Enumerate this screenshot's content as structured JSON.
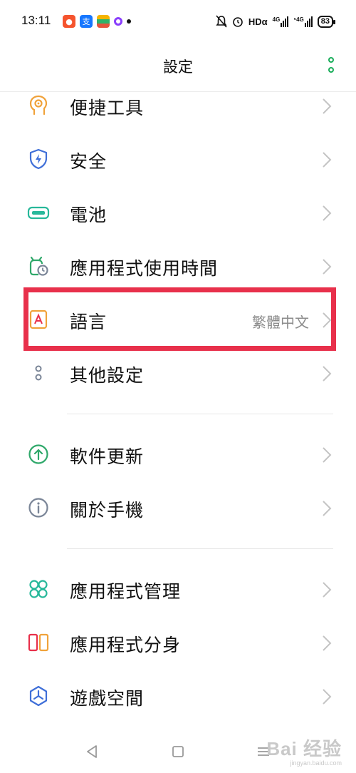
{
  "status_bar": {
    "time": "13:11",
    "hd_label": "HDα",
    "signal1_label": "4G",
    "signal2_label": "⁵4G",
    "battery": "83",
    "app_icon_text": "支"
  },
  "header": {
    "title": "設定"
  },
  "settings": {
    "items": [
      {
        "label": "便捷工具"
      },
      {
        "label": "安全"
      },
      {
        "label": "電池"
      },
      {
        "label": "應用程式使用時間"
      },
      {
        "label": "語言",
        "value": "繁體中文"
      },
      {
        "label": "其他設定"
      },
      {
        "label": "軟件更新"
      },
      {
        "label": "關於手機"
      },
      {
        "label": "應用程式管理"
      },
      {
        "label": "應用程式分身"
      },
      {
        "label": "遊戲空間"
      }
    ]
  },
  "watermark": {
    "main": "Bai 经验",
    "sub": "jingyan.baidu.com"
  },
  "colors": {
    "accent_green": "#1aad5a",
    "highlight_red": "#e8304b",
    "icon_orange": "#f0a23a",
    "icon_blue": "#3f6fd8",
    "icon_teal": "#27b89a",
    "icon_gray": "#7a8597"
  }
}
